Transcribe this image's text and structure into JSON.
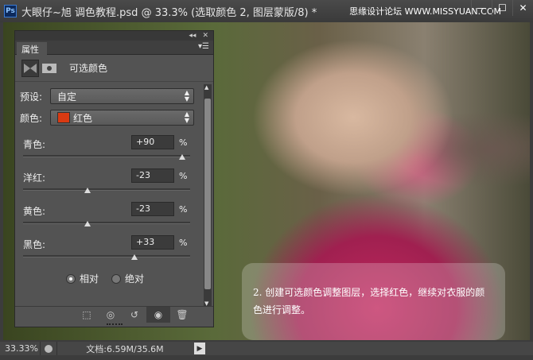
{
  "window": {
    "title": "大眼仔~旭 调色教程.psd @ 33.3% (选取颜色 2, 图层蒙版/8) *",
    "watermark": "思缘设计论坛 WWW.MISSYUAN.COM",
    "min": "—",
    "max": "☐",
    "close": "✕"
  },
  "panel": {
    "collapse": "◂◂",
    "close": "✕",
    "tab": "属性",
    "menu": "▾☰",
    "adjustment_title": "可选颜色",
    "preset_label": "预设:",
    "preset_value": "自定",
    "color_label": "颜色:",
    "color_value": "红色",
    "color_swatch": "#d93a12",
    "sliders": [
      {
        "label": "青色:",
        "value": "+90",
        "pct": "%",
        "num": 90
      },
      {
        "label": "洋红:",
        "value": "-23",
        "pct": "%",
        "num": -23
      },
      {
        "label": "黄色:",
        "value": "-23",
        "pct": "%",
        "num": -23
      },
      {
        "label": "黑色:",
        "value": "+33",
        "pct": "%",
        "num": 33
      }
    ],
    "method": {
      "relative": "相对",
      "absolute": "绝对",
      "selected": "relative"
    }
  },
  "caption": "2. 创建可选颜色调整图层，选择红色，继续对衣服的颜色进行调整。",
  "status": {
    "zoom": "33.33%",
    "doc": "文档:6.59M/35.6M",
    "arrow": "▶"
  }
}
